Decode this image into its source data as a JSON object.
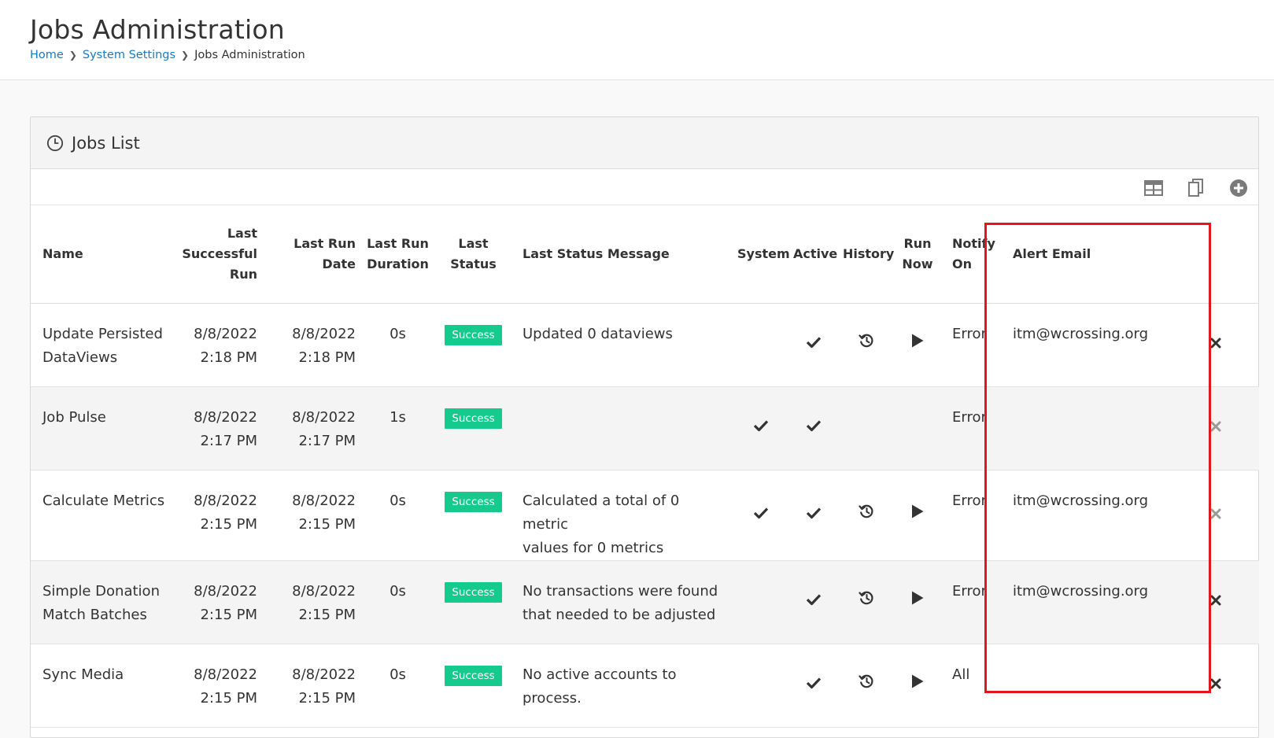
{
  "page": {
    "title": "Jobs Administration",
    "breadcrumb": [
      "Home",
      "System Settings",
      "Jobs Administration"
    ]
  },
  "panel": {
    "title": "Jobs List",
    "icon": "clock-icon",
    "toolbar": [
      "grid-icon",
      "copy-icon",
      "add-circle-icon"
    ]
  },
  "table": {
    "headers": {
      "name": "Name",
      "last_successful_run": [
        "Last",
        "Successful",
        "Run"
      ],
      "last_run_date": [
        "Last Run",
        "Date"
      ],
      "last_run_duration": [
        "Last Run",
        "Duration"
      ],
      "last_status": [
        "Last",
        "Status"
      ],
      "last_status_message": "Last Status Message",
      "system": "System",
      "active": "Active",
      "history": "History",
      "run_now": [
        "Run",
        "Now"
      ],
      "notify_on": [
        "Notify",
        "On"
      ],
      "alert_email": "Alert Email"
    },
    "rows": [
      {
        "name": [
          "Update Persisted",
          "DataViews"
        ],
        "last_successful": [
          "8/8/2022",
          "2:18 PM"
        ],
        "last_run": [
          "8/8/2022",
          "2:18 PM"
        ],
        "duration": "0s",
        "status": "Success",
        "message": [
          "Updated 0 dataviews",
          ""
        ],
        "system": false,
        "active": true,
        "history": true,
        "run_now": true,
        "notify_on": "Error",
        "alert_email": "itm@wcrossing.org",
        "delete_enabled": true
      },
      {
        "name": [
          "Job Pulse",
          ""
        ],
        "last_successful": [
          "8/8/2022",
          "2:17 PM"
        ],
        "last_run": [
          "8/8/2022",
          "2:17 PM"
        ],
        "duration": "1s",
        "status": "Success",
        "message": [
          "",
          ""
        ],
        "system": true,
        "active": true,
        "history": false,
        "run_now": false,
        "notify_on": "Error",
        "alert_email": "",
        "delete_enabled": false
      },
      {
        "name": [
          "Calculate Metrics",
          ""
        ],
        "last_successful": [
          "8/8/2022",
          "2:15 PM"
        ],
        "last_run": [
          "8/8/2022",
          "2:15 PM"
        ],
        "duration": "0s",
        "status": "Success",
        "message": [
          "Calculated a total of 0 metric",
          "values for 0 metrics"
        ],
        "system": true,
        "active": true,
        "history": true,
        "run_now": true,
        "notify_on": "Error",
        "alert_email": "itm@wcrossing.org",
        "delete_enabled": false
      },
      {
        "name": [
          "Simple Donation",
          "Match Batches"
        ],
        "last_successful": [
          "8/8/2022",
          "2:15 PM"
        ],
        "last_run": [
          "8/8/2022",
          "2:15 PM"
        ],
        "duration": "0s",
        "status": "Success",
        "message": [
          "No transactions were found",
          "that needed to be adjusted"
        ],
        "system": false,
        "active": true,
        "history": true,
        "run_now": true,
        "notify_on": "Error",
        "alert_email": "itm@wcrossing.org",
        "delete_enabled": true
      },
      {
        "name": [
          "Sync Media",
          ""
        ],
        "last_successful": [
          "8/8/2022",
          "2:15 PM"
        ],
        "last_run": [
          "8/8/2022",
          "2:15 PM"
        ],
        "duration": "0s",
        "status": "Success",
        "message": [
          "No active accounts to",
          "process."
        ],
        "system": false,
        "active": true,
        "history": true,
        "run_now": true,
        "notify_on": "All",
        "alert_email": "",
        "delete_enabled": true
      }
    ]
  },
  "colors": {
    "link": "#1a79c2",
    "success": "#16c98d",
    "highlight": "#e3161e",
    "row_alt": "#f4f4f4"
  }
}
